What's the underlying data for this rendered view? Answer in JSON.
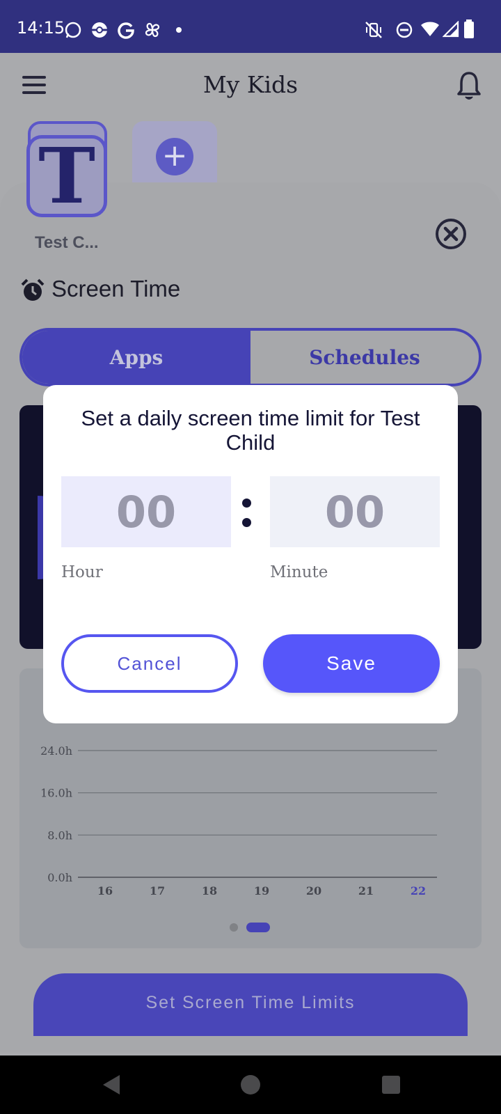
{
  "status_bar": {
    "time": "14:15"
  },
  "header": {
    "title": "My Kids"
  },
  "kids": [
    {
      "initial": "T",
      "name": "Test C..."
    }
  ],
  "add_kid_symbol": "+",
  "section": {
    "title": "Screen Time"
  },
  "tabs": [
    {
      "label": "Apps",
      "active": true
    },
    {
      "label": "Schedules",
      "active": false
    }
  ],
  "chart_data": {
    "type": "bar",
    "categories": [
      "16",
      "17",
      "18",
      "19",
      "20",
      "21",
      "22"
    ],
    "values": [
      0,
      0,
      0,
      0,
      0,
      0,
      0
    ],
    "y_ticks": [
      "0.0h",
      "8.0h",
      "16.0h",
      "24.0h"
    ],
    "ylim": [
      0,
      24
    ],
    "highlight_category": "22",
    "grid": true
  },
  "pager": {
    "pages": 2,
    "active": 2
  },
  "primary_action": {
    "label": "Set Screen Time Limits"
  },
  "dialog": {
    "title": "Set a daily screen time limit for Test Child",
    "hour_value": "00",
    "minute_value": "00",
    "hour_label": "Hour",
    "minute_label": "Minute",
    "cancel_label": "Cancel",
    "save_label": "Save"
  },
  "colors": {
    "accent": "#4643b6",
    "dialog_button": "#5656fa",
    "status_bar": "#30307f",
    "highlight_tick": "#4643b6"
  }
}
